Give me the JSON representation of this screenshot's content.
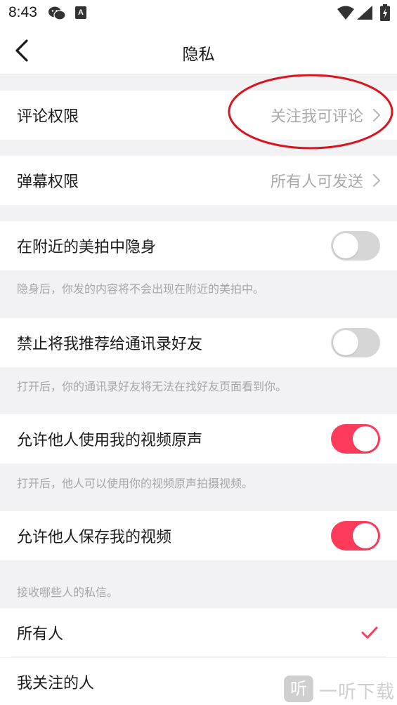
{
  "status_bar": {
    "time": "8:43",
    "icons": [
      "wechat-icon",
      "a-notification-icon",
      "wifi-icon",
      "signal-icon",
      "battery-charging-icon"
    ],
    "notification_letter": "A"
  },
  "nav": {
    "title": "隐私",
    "back_icon": "chevron-left-icon"
  },
  "settings": {
    "comment_permission": {
      "label": "评论权限",
      "value": "关注我可评论"
    },
    "danmaku_permission": {
      "label": "弹幕权限",
      "value": "所有人可发送"
    },
    "hide_nearby": {
      "label": "在附近的美拍中隐身",
      "enabled": false,
      "hint": "隐身后，你发的内容将不会出现在附近的美拍中。"
    },
    "block_contacts": {
      "label": "禁止将我推荐给通讯录好友",
      "enabled": false,
      "hint": "打开后，你的通讯录好友将无法在找好友页面看到你。"
    },
    "allow_sound": {
      "label": "允许他人使用我的视频原声",
      "enabled": true,
      "hint": "打开后，他人可以使用你的视频原声拍摄视频。"
    },
    "allow_save": {
      "label": "允许他人保存我的视频",
      "enabled": true
    }
  },
  "messages": {
    "header": "接收哪些人的私信。",
    "options": [
      {
        "label": "所有人",
        "selected": true
      },
      {
        "label": "我关注的人",
        "selected": false
      }
    ]
  },
  "watermark": {
    "logo_char": "听",
    "text": "一听下载"
  },
  "colors": {
    "accent": "#ff3b5c",
    "annotation": "#d9141e",
    "toggle_off": "#d6d6d6",
    "background": "#f2f2f4"
  }
}
